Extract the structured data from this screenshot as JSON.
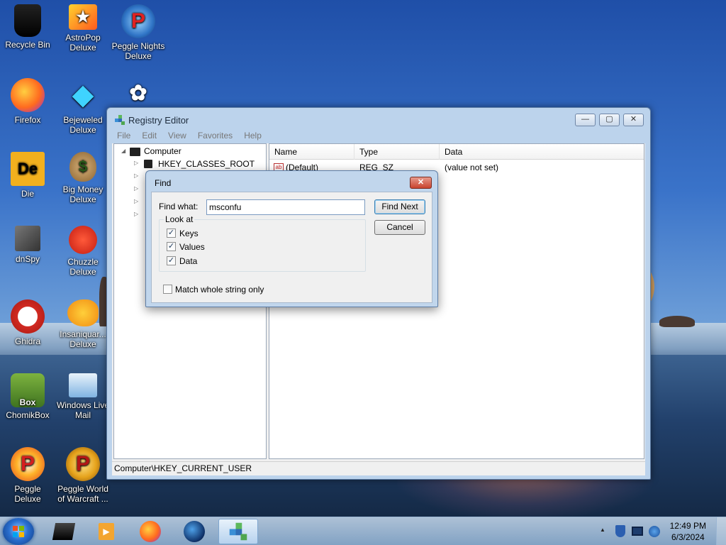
{
  "desktop": {
    "icons": [
      {
        "label": "Recycle Bin",
        "icon": "recycle-bin-icon"
      },
      {
        "label": "AstroPop Deluxe",
        "icon": "astropop-icon"
      },
      {
        "label": "Peggle Nights Deluxe",
        "icon": "peggle-nights-icon"
      },
      {
        "label": "Firefox",
        "icon": "firefox-icon"
      },
      {
        "label": "Bejeweled Deluxe",
        "icon": "bejeweled-icon"
      },
      {
        "label": "Die",
        "icon": "die-icon"
      },
      {
        "label": "Big Money Deluxe",
        "icon": "money-bag-icon"
      },
      {
        "label": "dnSpy",
        "icon": "dnspy-icon"
      },
      {
        "label": "Chuzzle Deluxe",
        "icon": "chuzzle-icon"
      },
      {
        "label": "Ghidra",
        "icon": "ghidra-icon"
      },
      {
        "label": "Insaniquar... Deluxe",
        "icon": "insaniquarium-icon"
      },
      {
        "label": "ChomikBox",
        "icon": "chomikbox-icon"
      },
      {
        "label": "Windows Live Mail",
        "icon": "windows-live-mail-icon"
      },
      {
        "label": "Peggle Deluxe",
        "icon": "peggle-icon"
      },
      {
        "label": "Peggle World of Warcraft ...",
        "icon": "peggle-wow-icon"
      }
    ]
  },
  "regedit": {
    "title": "Registry Editor",
    "menu": [
      "File",
      "Edit",
      "View",
      "Favorites",
      "Help"
    ],
    "tree": {
      "root": "Computer",
      "first_child": "HKEY_CLASSES_ROOT"
    },
    "columns": [
      "Name",
      "Type",
      "Data"
    ],
    "rows": [
      {
        "name": "(Default)",
        "type": "REG_SZ",
        "data": "(value not set)"
      }
    ],
    "status": "Computer\\HKEY_CURRENT_USER",
    "caption_buttons": {
      "minimize": "—",
      "maximize": "▢",
      "close": "✕"
    }
  },
  "find_dialog": {
    "title": "Find",
    "find_what_label": "Find what:",
    "find_what_value": "msconfu",
    "find_next": "Find Next",
    "cancel": "Cancel",
    "look_at_label": "Look at",
    "options": [
      {
        "label": "Keys",
        "checked": true
      },
      {
        "label": "Values",
        "checked": true
      },
      {
        "label": "Data",
        "checked": true
      }
    ],
    "match_whole": {
      "label": "Match whole string only",
      "checked": false
    },
    "close_glyph": "✕"
  },
  "taskbar": {
    "clock_time": "12:49 PM",
    "clock_date": "6/3/2024",
    "tray_chevron": "▲"
  }
}
